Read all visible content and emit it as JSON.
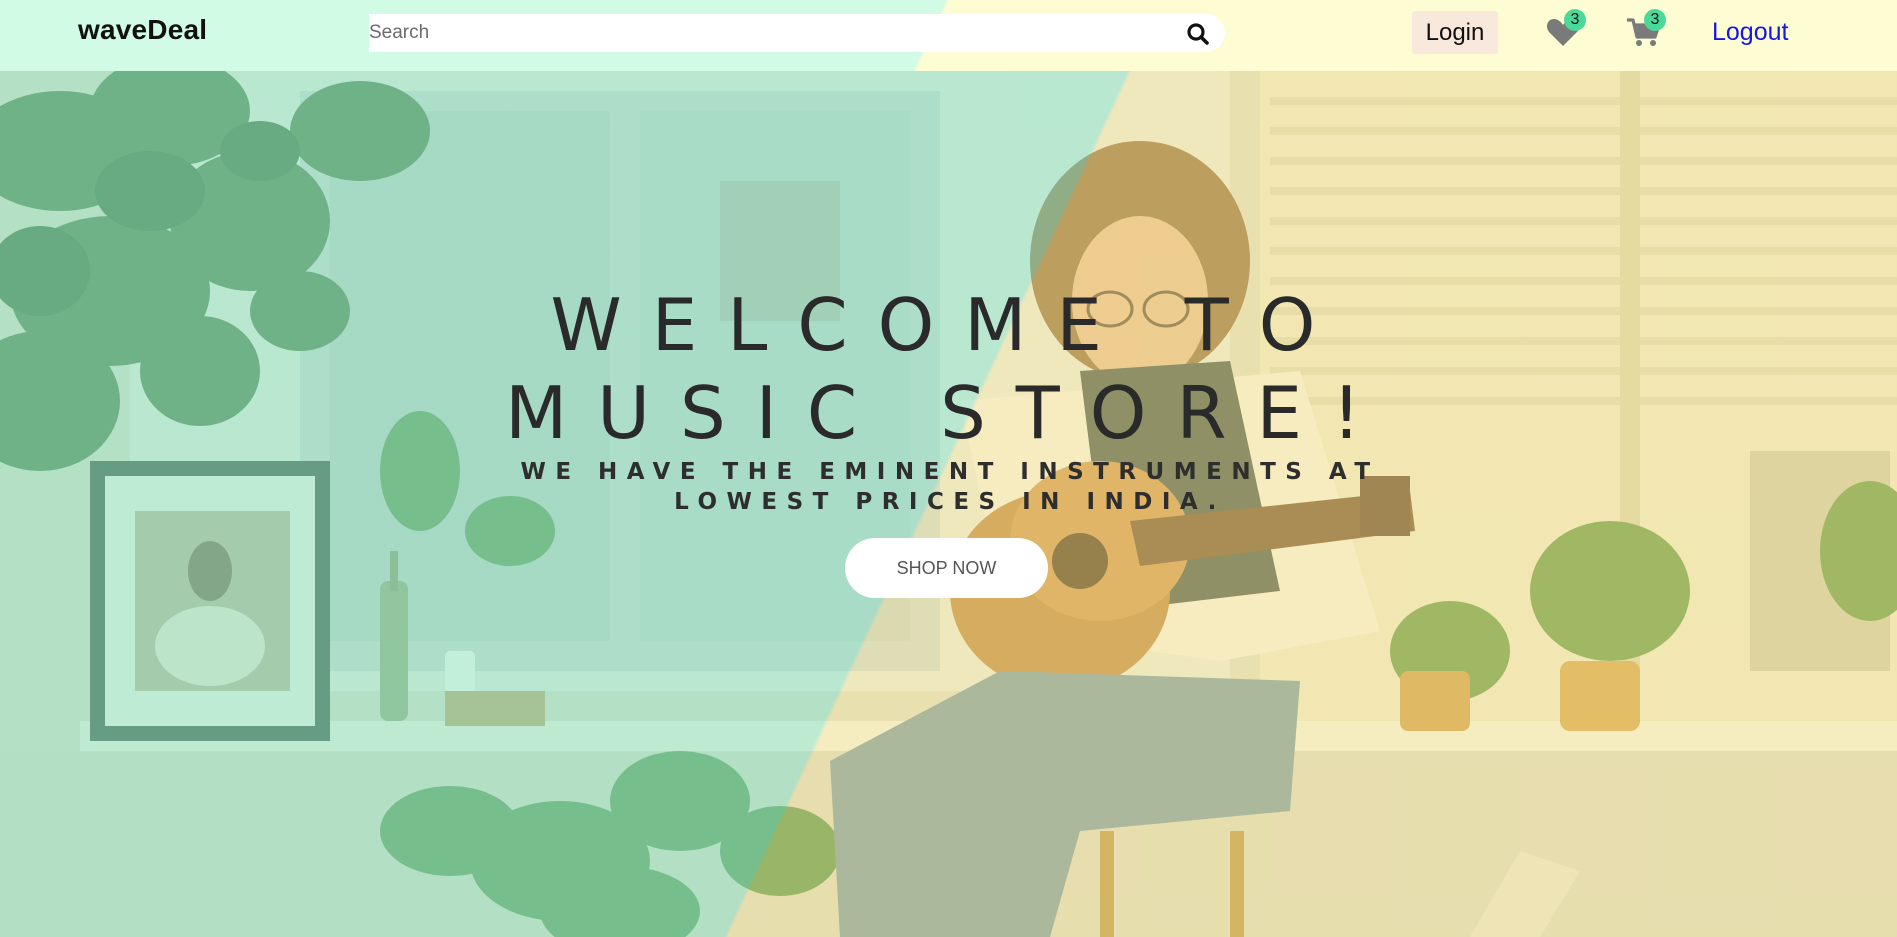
{
  "navbar": {
    "brand": "waveDeal",
    "search_placeholder": "Search",
    "search_icon": "search-icon",
    "login_label": "Login",
    "wishlist_icon": "heart-icon",
    "wishlist_count": "3",
    "cart_icon": "cart-icon",
    "cart_count": "3",
    "logout_label": "Logout"
  },
  "hero": {
    "title": "WELCOME TO MUSIC STORE!",
    "subtitle": "WE HAVE THE EMINENT INSTRUMENTS AT LOWEST PRICES IN INDIA.",
    "cta_label": "SHOP NOW",
    "background_image": "woman-playing-guitar-photo"
  },
  "colors": {
    "nav_left": "#d2fbe6",
    "nav_right": "#fefcd2",
    "logout_link": "#1515e6",
    "badge": "#4bd99a",
    "login_bg": "#f9e8dc"
  }
}
